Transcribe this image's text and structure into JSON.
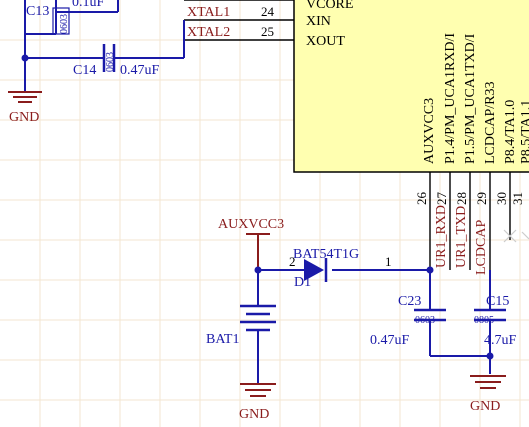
{
  "colors": {
    "wire": "#1a1aa8",
    "net_label": "#8a1c1c",
    "ic_fill": "#ffffb0",
    "grid": "#f3e6d0"
  },
  "ic": {
    "pins_left": [
      {
        "net": "XTAL1",
        "num": "24",
        "name": "XIN"
      },
      {
        "net": "XTAL2",
        "num": "25",
        "name": "XOUT"
      }
    ],
    "top_pin_name": "VCORE",
    "pins_bottom": [
      {
        "num": "26",
        "name": "AUXVCC3"
      },
      {
        "num": "27",
        "name": "P1.4/PM_UCA1RXD/I"
      },
      {
        "num": "28",
        "name": "P1.5/PM_UCA1TXD/I"
      },
      {
        "num": "29",
        "name": "LCDCAP/R33"
      },
      {
        "num": "30",
        "name": "P8.4/TA1.0"
      },
      {
        "num": "31",
        "name": "P8.5/TA1.1"
      }
    ],
    "bottom_net_labels": [
      "UR1_RXD",
      "UR1_TXD",
      "LCDCAP"
    ]
  },
  "c13": {
    "ref": "C13",
    "package": "0603",
    "value": "0.1uF"
  },
  "c14": {
    "ref": "C14",
    "package": "0603",
    "value": "0.47uF"
  },
  "c23": {
    "ref": "C23",
    "package": "0603",
    "value": "0.47uF"
  },
  "c15": {
    "ref": "C15",
    "package": "0805",
    "value": "4.7uF"
  },
  "d1": {
    "ref": "D1",
    "part": "BAT54T1G",
    "pin_a": "2",
    "pin_k": "1"
  },
  "bat1": {
    "ref": "BAT1"
  },
  "power": {
    "auxvcc3": "AUXVCC3"
  },
  "gnd": {
    "label": "GND"
  }
}
